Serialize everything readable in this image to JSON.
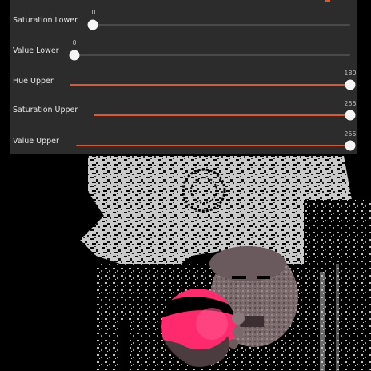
{
  "colors": {
    "panel_background": "#2c2c2c",
    "accent": "#e95420",
    "track": "#4a4a4a",
    "thumb": "#f5f5f5",
    "mask_highlight": "#ff2a6d"
  },
  "sliders": [
    {
      "label": "Saturation Lower",
      "value": "0",
      "min": 0,
      "max": 255
    },
    {
      "label": "Value Lower",
      "value": "0",
      "min": 0,
      "max": 255
    },
    {
      "label": "Hue Upper",
      "value": "180",
      "min": 0,
      "max": 180
    },
    {
      "label": "Saturation Upper",
      "value": "255",
      "min": 0,
      "max": 255
    },
    {
      "label": "Value Upper",
      "value": "255",
      "min": 0,
      "max": 255
    }
  ],
  "video": {
    "icon": "camera-feed-masked-image"
  }
}
